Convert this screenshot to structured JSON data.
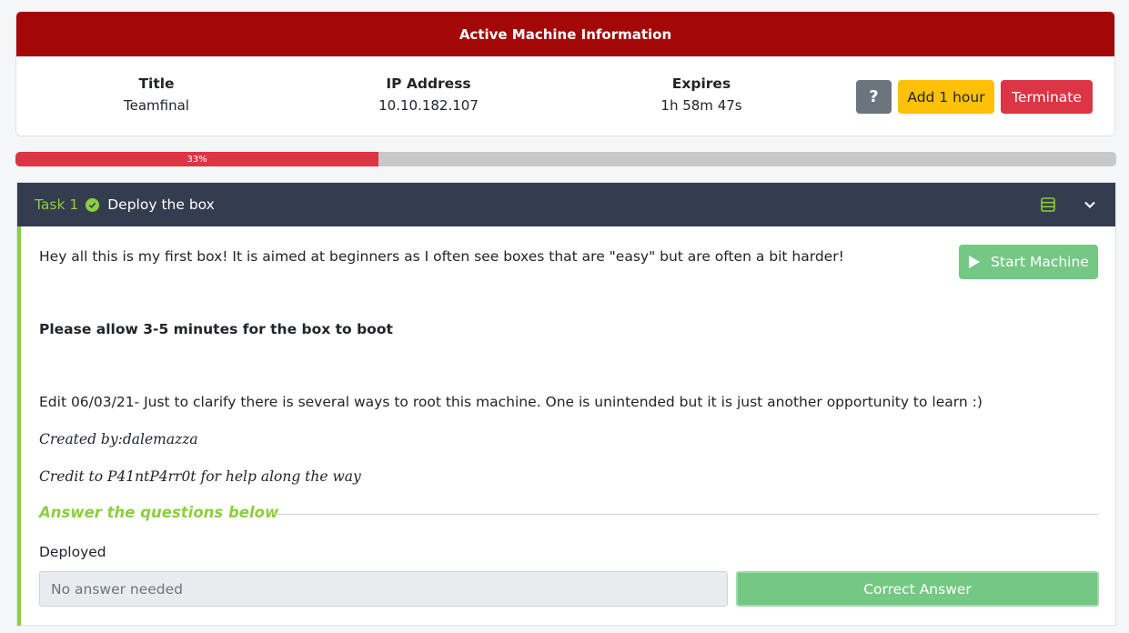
{
  "machine": {
    "header": "Active Machine Information",
    "title_label": "Title",
    "title_value": "Teamfinal",
    "ip_label": "IP Address",
    "ip_value": "10.10.182.107",
    "expires_label": "Expires",
    "expires_value": "1h 58m 47s",
    "help_label": "?",
    "add_hour_label": "Add 1 hour",
    "terminate_label": "Terminate"
  },
  "progress": {
    "label": "33%",
    "value": 33
  },
  "task": {
    "number": "Task 1",
    "title": "Deploy the box",
    "start_button": "Start Machine",
    "para1": "Hey all this is my first box! It is aimed at beginners as I often see boxes that are \"easy\" but are often a bit harder!",
    "para2": "Please allow 3-5 minutes for the box to boot",
    "para3": "Edit 06/03/21- Just to clarify there is several ways to root this machine. One is unintended but it is just another opportunity to learn :)",
    "para4": "Created by:dalemazza",
    "para5": "Credit to P41ntP4rr0t for help along the way",
    "answer_heading": "Answer the questions below",
    "question": "Deployed",
    "answer_placeholder": "No answer needed",
    "correct_label": "Correct Answer"
  },
  "colors": {
    "header_red": "#a30708",
    "accent_green": "#8ccf3f",
    "button_green": "#74c883",
    "warning_yellow": "#ffc107",
    "danger_red": "#dc3545",
    "task_header": "#343d4f"
  }
}
